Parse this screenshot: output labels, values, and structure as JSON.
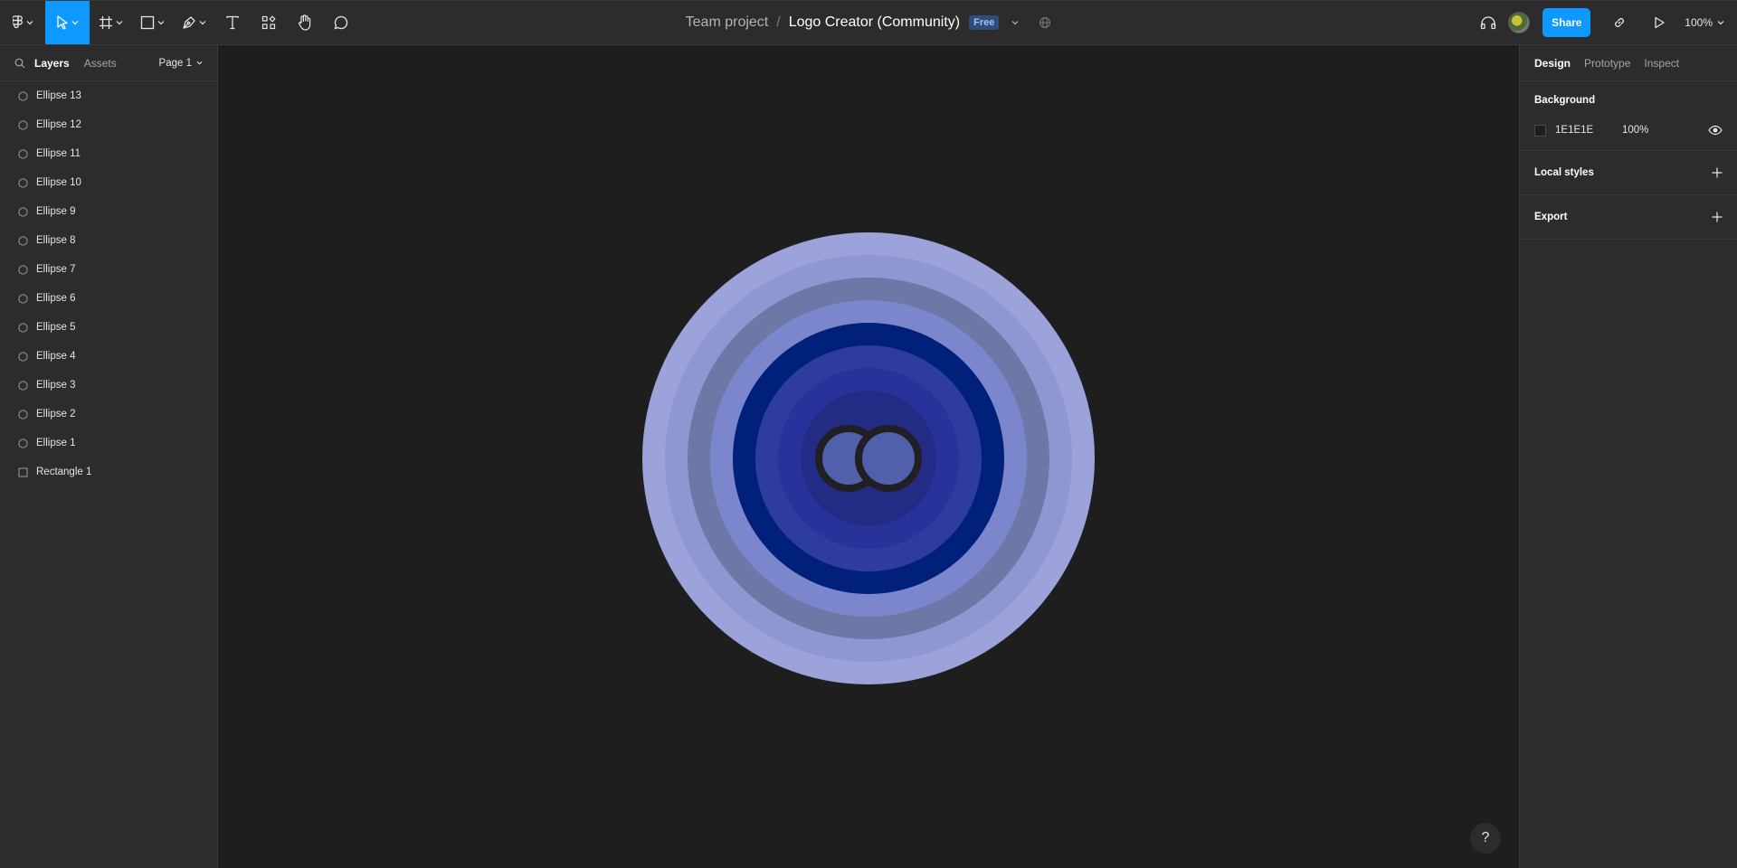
{
  "toolbar": {
    "tools": [
      "main-menu",
      "move",
      "frame",
      "shape",
      "pen",
      "text",
      "resources",
      "hand",
      "comment"
    ],
    "active_tool": "move"
  },
  "title": {
    "team": "Team project",
    "separator": "/",
    "file": "Logo Creator (Community)",
    "badge": "Free"
  },
  "right_toolbar": {
    "share_label": "Share",
    "zoom": "100%"
  },
  "left_panel": {
    "tabs": {
      "layers": "Layers",
      "assets": "Assets"
    },
    "page": "Page 1",
    "layers": [
      {
        "name": "Ellipse 13",
        "type": "ellipse"
      },
      {
        "name": "Ellipse 12",
        "type": "ellipse"
      },
      {
        "name": "Ellipse 11",
        "type": "ellipse"
      },
      {
        "name": "Ellipse 10",
        "type": "ellipse"
      },
      {
        "name": "Ellipse 9",
        "type": "ellipse"
      },
      {
        "name": "Ellipse 8",
        "type": "ellipse"
      },
      {
        "name": "Ellipse 7",
        "type": "ellipse"
      },
      {
        "name": "Ellipse 6",
        "type": "ellipse"
      },
      {
        "name": "Ellipse 5",
        "type": "ellipse"
      },
      {
        "name": "Ellipse 4",
        "type": "ellipse"
      },
      {
        "name": "Ellipse 3",
        "type": "ellipse"
      },
      {
        "name": "Ellipse 2",
        "type": "ellipse"
      },
      {
        "name": "Ellipse 1",
        "type": "ellipse"
      },
      {
        "name": "Rectangle 1",
        "type": "rectangle"
      }
    ]
  },
  "right_panel": {
    "tabs": {
      "design": "Design",
      "prototype": "Prototype",
      "inspect": "Inspect"
    },
    "background": {
      "label": "Background",
      "hex": "1E1E1E",
      "opacity": "100%"
    },
    "local_styles": "Local styles",
    "export": "Export"
  },
  "canvas": {
    "background": "#1e1e1e",
    "logo": {
      "ring_colors": [
        "#9ca3da",
        "#8e97d2",
        "#6e78a6",
        "#7c86cc",
        "#00207a",
        "#2d3c9e",
        "#27339a",
        "#232c84"
      ],
      "inner_circle_color": "#5060aa",
      "inner_stroke_color": "#1f1f24"
    }
  },
  "colors": {
    "accent": "#0d99ff",
    "panel": "#2c2c2c",
    "badge_bg": "#2f4d78",
    "badge_text": "#9dc1ff"
  },
  "help": "?"
}
